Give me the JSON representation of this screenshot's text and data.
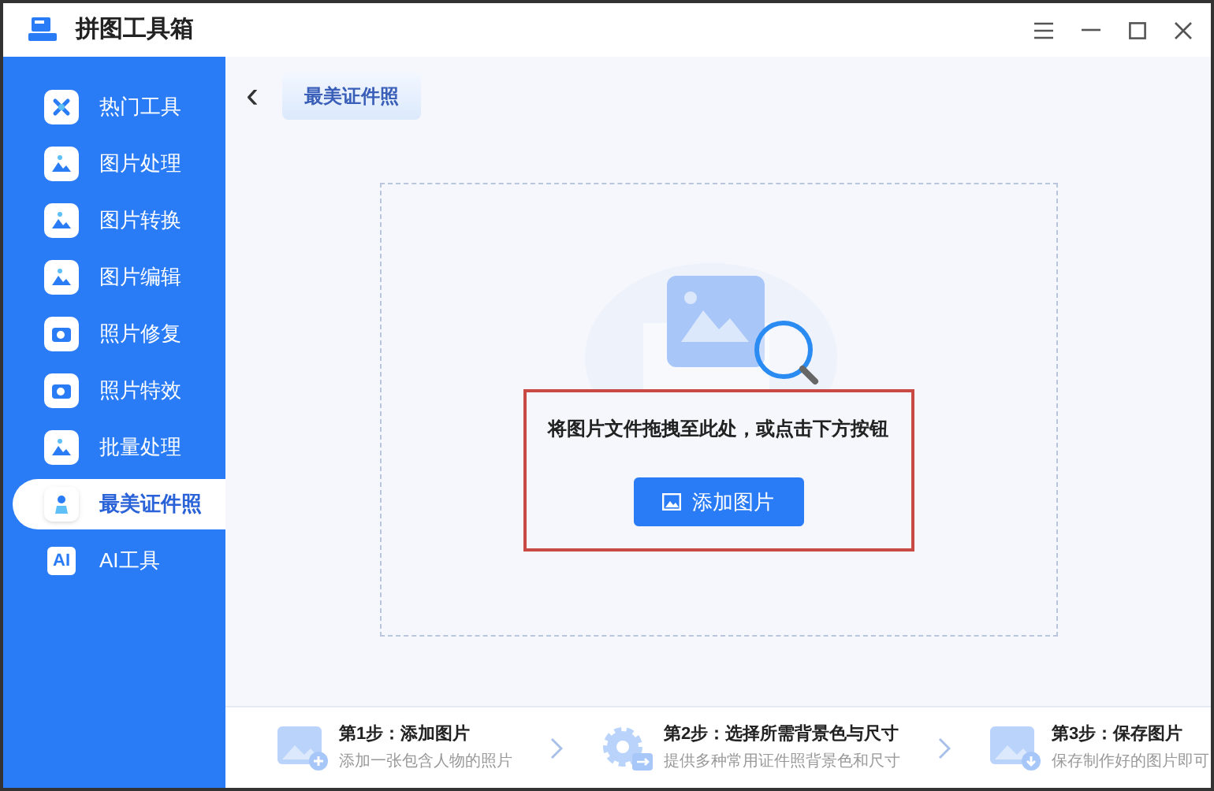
{
  "window": {
    "title": "拼图工具箱"
  },
  "sidebar": {
    "items": [
      {
        "label": "热门工具",
        "kind": "tools",
        "selected": false
      },
      {
        "label": "图片处理",
        "kind": "image",
        "selected": false
      },
      {
        "label": "图片转换",
        "kind": "image",
        "selected": false
      },
      {
        "label": "图片编辑",
        "kind": "image",
        "selected": false
      },
      {
        "label": "照片修复",
        "kind": "camera",
        "selected": false
      },
      {
        "label": "照片特效",
        "kind": "camera",
        "selected": false
      },
      {
        "label": "批量处理",
        "kind": "image",
        "selected": false
      },
      {
        "label": "最美证件照",
        "kind": "person",
        "selected": true
      },
      {
        "label": "AI工具",
        "kind": "ai",
        "icon_text": "AI",
        "selected": false
      }
    ]
  },
  "header": {
    "back": "‹",
    "tab": "最美证件照"
  },
  "dropzone": {
    "hint": "将图片文件拖拽至此处，或点击下方按钮",
    "button": "添加图片"
  },
  "steps": [
    {
      "kind": "add",
      "title": "第1步：添加图片",
      "desc": "添加一张包含人物的照片"
    },
    {
      "kind": "settings",
      "title": "第2步：选择所需背景色与尺寸",
      "desc": "提供多种常用证件照背景色和尺寸"
    },
    {
      "kind": "save",
      "title": "第3步：保存图片",
      "desc": "保存制作好的图片即可"
    }
  ]
}
